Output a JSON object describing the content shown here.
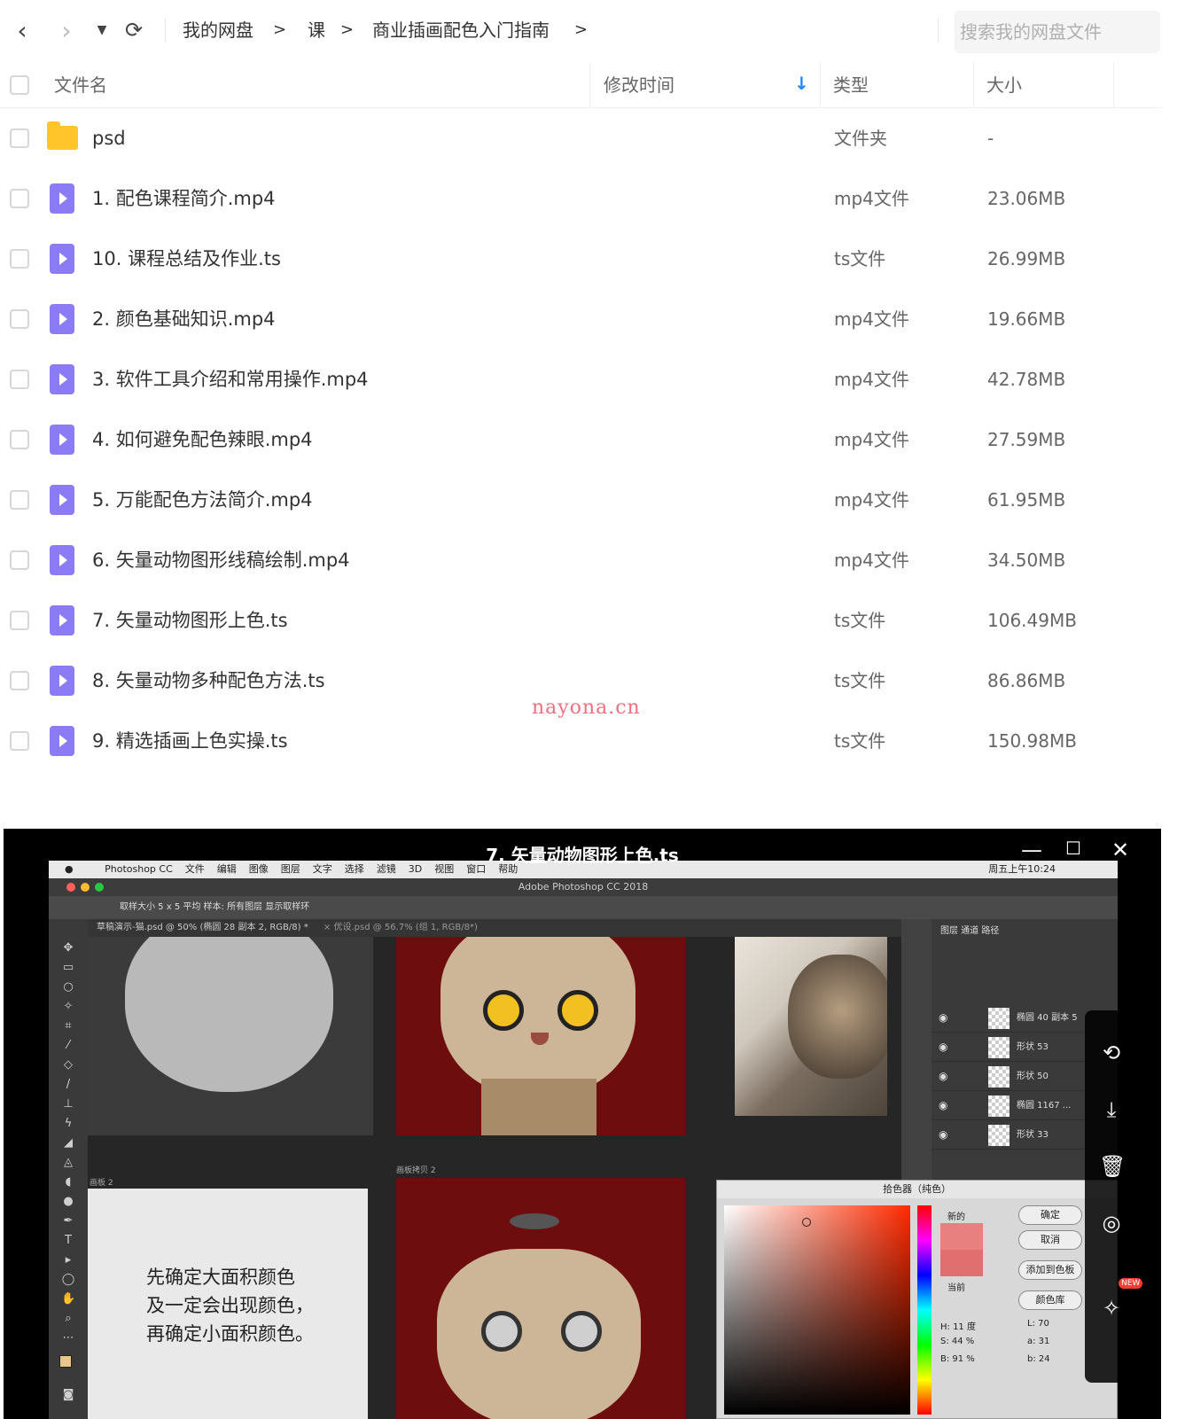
{
  "toolbar": {
    "back_icon": "chevron-left-icon",
    "forward_icon": "chevron-right-icon",
    "refresh_icon": "refresh-icon",
    "breadcrumb": [
      "我的网盘",
      "课",
      "商业插画配色入门指南"
    ],
    "separator": ">",
    "search_placeholder": "搜索我的网盘文件"
  },
  "table": {
    "columns": {
      "name": "文件名",
      "modified": "修改时间",
      "type": "类型",
      "size": "大小"
    },
    "rows": [
      {
        "name": "psd",
        "type": "文件夹",
        "size": "-",
        "icon": "folder-icon"
      },
      {
        "name": "1. 配色课程简介.mp4",
        "type": "mp4文件",
        "size": "23.06MB",
        "icon": "video-file-icon"
      },
      {
        "name": "10. 课程总结及作业.ts",
        "type": "ts文件",
        "size": "26.99MB",
        "icon": "video-file-icon"
      },
      {
        "name": "2. 颜色基础知识.mp4",
        "type": "mp4文件",
        "size": "19.66MB",
        "icon": "video-file-icon"
      },
      {
        "name": "3. 软件工具介绍和常用操作.mp4",
        "type": "mp4文件",
        "size": "42.78MB",
        "icon": "video-file-icon"
      },
      {
        "name": "4. 如何避免配色辣眼.mp4",
        "type": "mp4文件",
        "size": "27.59MB",
        "icon": "video-file-icon"
      },
      {
        "name": "5. 万能配色方法简介.mp4",
        "type": "mp4文件",
        "size": "61.95MB",
        "icon": "video-file-icon"
      },
      {
        "name": "6. 矢量动物图形线稿绘制.mp4",
        "type": "mp4文件",
        "size": "34.50MB",
        "icon": "video-file-icon"
      },
      {
        "name": "7. 矢量动物图形上色.ts",
        "type": "ts文件",
        "size": "106.49MB",
        "icon": "video-file-icon"
      },
      {
        "name": "8. 矢量动物多种配色方法.ts",
        "type": "ts文件",
        "size": "86.86MB",
        "icon": "video-file-icon"
      },
      {
        "name": "9. 精选插画上色实操.ts",
        "type": "ts文件",
        "size": "150.98MB",
        "icon": "video-file-icon"
      }
    ]
  },
  "watermark": "nayona.cn",
  "player": {
    "title": "7. 矢量动物图形上色.ts",
    "minimize": "—",
    "maximize": "☐",
    "close": "✕",
    "side_actions": [
      "share-icon",
      "download-icon",
      "delete-icon",
      "target-icon",
      "pin-icon"
    ],
    "new_badge": "NEW"
  },
  "photoshop": {
    "menu": [
      "Photoshop CC",
      "文件",
      "编辑",
      "图像",
      "图层",
      "文字",
      "选择",
      "滤镜",
      "3D",
      "视图",
      "窗口",
      "帮助"
    ],
    "clock": "周五上午10:24",
    "window_title": "Adobe Photoshop CC 2018",
    "options": "取样大小  5 x 5 平均    样本:  所有图层      显示取样环",
    "doc_tab_1": "草稿演示-猫.psd @ 50% (椭圆 28 副本 2, RGB/8) *",
    "doc_tab_2": "× 优设.psd @ 56.7% (组 1, RGB/8*)",
    "artboard_label_1": "画板 2",
    "artboard_label_2": "画板拷贝 2",
    "tutorial_lines": [
      "先确定大面积颜色",
      "及一定会出现颜色，",
      "再确定小面积颜色。"
    ],
    "layers_tabs": "图层   通道   路径",
    "layers": [
      "椭圆 40 副本 5",
      "形状 53",
      "形状 50",
      "椭圆 1167 ...",
      "形状 33"
    ],
    "picker_title": "拾色器（纯色）",
    "picker_buttons": [
      "确定",
      "取消",
      "添加到色板",
      "颜色库"
    ],
    "picker_new_label": "新的",
    "picker_current_label": "当前",
    "hsb": [
      "H: 11 度",
      "S: 44 %",
      "B: 91 %"
    ],
    "lab": [
      "L: 70",
      "a: 31",
      "b: 24"
    ]
  },
  "colors": {
    "accent": "#1e88ff",
    "file_icon": "#8b7cf6",
    "folder_icon": "#ffc52b",
    "watermark": "#f07080",
    "artboard_red": "#6e0d0d"
  }
}
